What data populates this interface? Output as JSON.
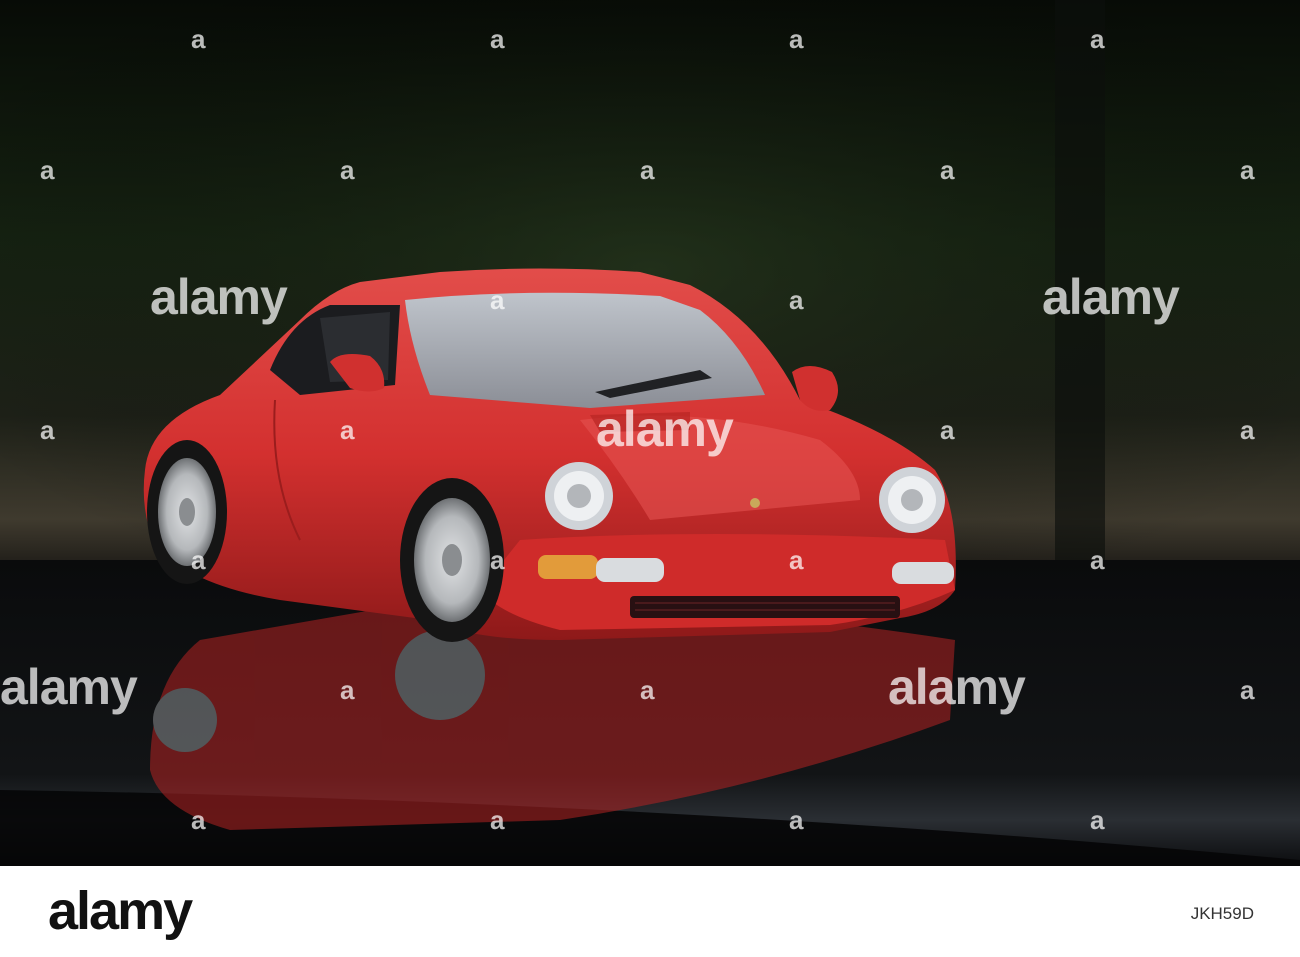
{
  "watermark": {
    "word": "alamy",
    "letter": "a"
  },
  "footer": {
    "logo": "alamy",
    "image_id": "JKH59D"
  }
}
